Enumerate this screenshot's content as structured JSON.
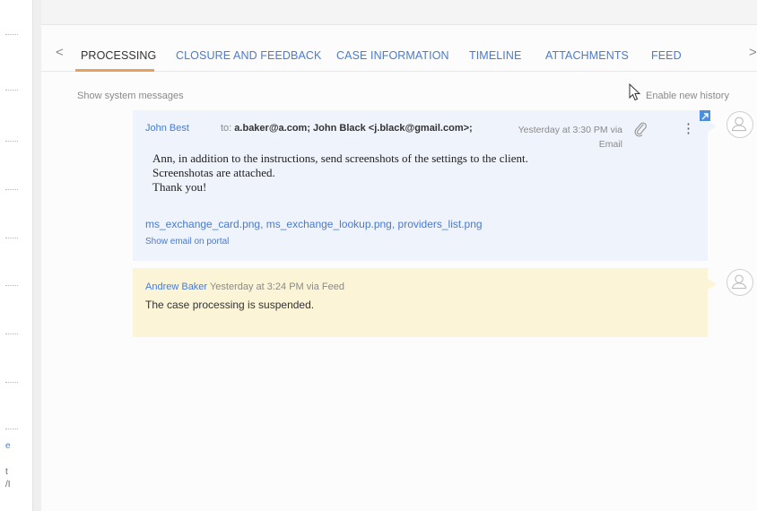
{
  "left_sidebar": {
    "chars": [
      "e",
      "t",
      "/I"
    ]
  },
  "tabs": {
    "items": [
      {
        "label": "PROCESSING",
        "active": true
      },
      {
        "label": "CLOSURE AND FEEDBACK"
      },
      {
        "label": "CASE INFORMATION"
      },
      {
        "label": "TIMELINE"
      },
      {
        "label": "ATTACHMENTS"
      },
      {
        "label": "FEED"
      }
    ],
    "prev_glyph": "<",
    "next_glyph": ">"
  },
  "history_bar": {
    "show_system_messages": "Show system messages",
    "enable_new_history": "Enable new history"
  },
  "email_message": {
    "author": "John Best",
    "to_label": "to:",
    "recipients": "a.baker@a.com; John Black <j.black@gmail.com>;",
    "time": "Yesterday at 3:30 PM via Email",
    "body_line1": "Ann, in addition to the instructions, send screenshots of the settings to the client.",
    "body_line2": "Screenshotas are attached.",
    "body_line3": "Thank you!",
    "attachments": "ms_exchange_card.png, ms_exchange_lookup.png, providers_list.png",
    "portal_link": "Show email on portal",
    "kebab_glyph": "⋮"
  },
  "feed_message": {
    "author": "Andrew Baker",
    "time": "Yesterday at 3:24 PM via Feed",
    "text": "The case processing is suspended."
  },
  "colors": {
    "link": "#4a7bd0",
    "email_bg": "#eef3fc",
    "feed_bg": "#fbf4d6",
    "active_tab_underline": "#e8a060"
  }
}
